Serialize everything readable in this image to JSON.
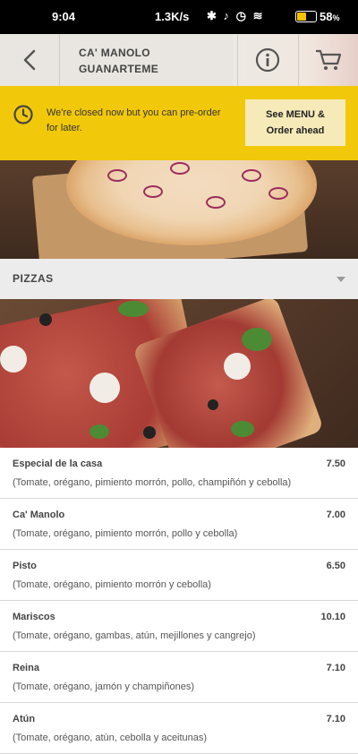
{
  "status_bar": {
    "time": "9:04",
    "network_speed": "1.3K/s",
    "battery_percent": "58",
    "battery_level": 0.58
  },
  "header": {
    "title_line1": "CA' MANOLO",
    "title_line2": "GUANARTEME",
    "back_icon": "chevron-left-icon",
    "info_icon": "info-circle-icon",
    "cart_icon": "cart-icon"
  },
  "banner": {
    "message": "We're closed now but you can pre-order for later.",
    "button_line1": "See MENU &",
    "button_line2": "Order ahead",
    "color": "#f2c80b"
  },
  "category": {
    "title": "PIZZAS"
  },
  "menu_items": [
    {
      "name": "Especial de la casa",
      "price": "7.50",
      "description": "(Tomate, orégano, pimiento morrón, pollo, champiñón y cebolla)"
    },
    {
      "name": "Ca' Manolo",
      "price": "7.00",
      "description": "(Tomate, orégano, pimiento morrón, pollo y cebolla)"
    },
    {
      "name": "Pisto",
      "price": "6.50",
      "description": "(Tomate, orégano, pimiento morrón y cebolla)"
    },
    {
      "name": "Mariscos",
      "price": "10.10",
      "description": "(Tomate, orégano, gambas, atún, mejillones y cangrejo)"
    },
    {
      "name": "Reina",
      "price": "7.10",
      "description": "(Tomate, orégano, jamón y champiñones)"
    },
    {
      "name": "Atún",
      "price": "7.10",
      "description": "(Tomate, orégano, atún, cebolla y aceitunas)"
    }
  ]
}
